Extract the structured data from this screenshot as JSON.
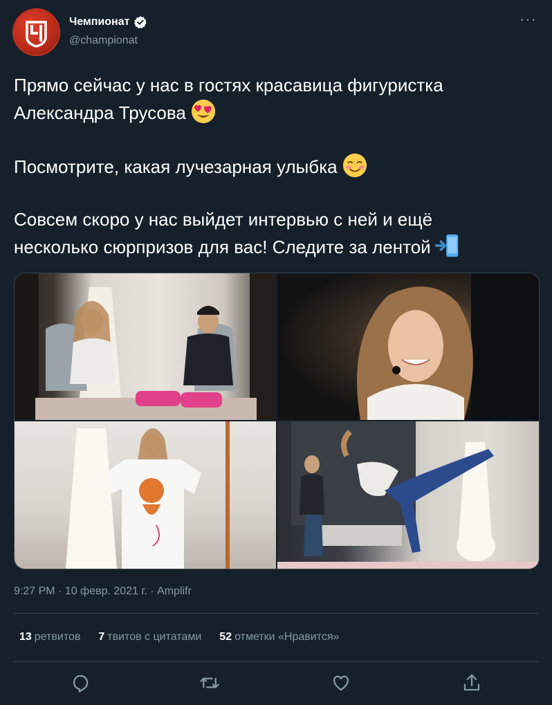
{
  "account": {
    "display_name": "Чемпионат",
    "handle": "@championat",
    "verified": true,
    "avatar_icon": "championat-logo"
  },
  "more_label": "···",
  "tweet": {
    "line1": "Прямо сейчас у нас в гостях красавица фигуристка",
    "line2": "Александра Трусова",
    "line2_emoji": "heart-eyes-emoji",
    "line3": "Посмотрите, какая лучезарная улыбка",
    "line3_emoji": "smiling-blush-emoji",
    "line4": "Совсем скоро у нас выйдет интервью с ней и ещё",
    "line5": "несколько сюрпризов для вас! Следите за лентой",
    "line5_emoji": "mobile-arrow-emoji"
  },
  "media": [
    {
      "desc_icon": "photo-interview-two-people"
    },
    {
      "desc_icon": "photo-closeup-smile"
    },
    {
      "desc_icon": "photo-tshirt-tiger"
    },
    {
      "desc_icon": "photo-spiral-pose"
    }
  ],
  "meta": {
    "time": "9:27 PM",
    "sep1": " · ",
    "date": "10 февр. 2021 г.",
    "sep2": " · ",
    "source": "Amplifr"
  },
  "stats": {
    "retweets_count": "13",
    "retweets_label": "ретвитов",
    "quotes_count": "7",
    "quotes_label": "твитов с цитатами",
    "likes_count": "52",
    "likes_label": "отметки «Нравится»"
  },
  "actions": [
    "reply-icon",
    "retweet-icon",
    "like-icon",
    "share-icon"
  ],
  "colors": {
    "background": "#15202b",
    "secondary_text": "#8899a6",
    "divider": "#38444d",
    "verified": "#ffffff"
  }
}
